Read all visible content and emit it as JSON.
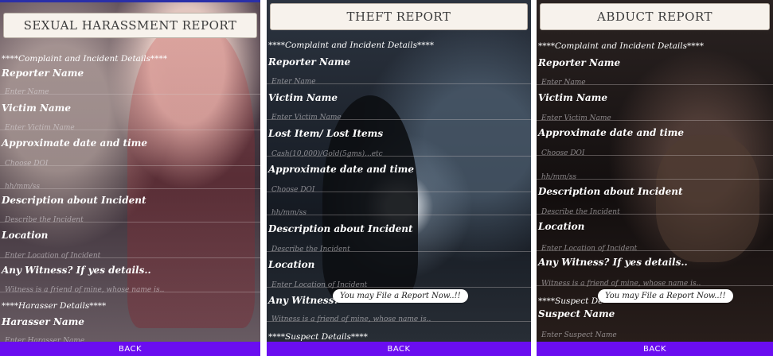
{
  "screens": [
    {
      "title": "SEXUAL HARASSMENT REPORT",
      "section_header": "****Complaint and Incident Details****",
      "reporter_label": "Reporter Name",
      "reporter_placeholder": "Enter Name",
      "victim_label": "Victim Name",
      "victim_placeholder": "Enter Victim Name",
      "datetime_label": "Approximate date and time",
      "date_placeholder": "Choose DOI",
      "time_placeholder": "hh/mm/ss",
      "description_label": "Description about Incident",
      "description_placeholder": "Describe the Incident",
      "location_label": "Location",
      "location_placeholder": "Enter Location of Incident",
      "witness_label": "Any Witness? If yes details..",
      "witness_placeholder": "Witness is a friend of mine, whose name is..",
      "section2_header": "****Harasser Details****",
      "harasser_label": "Harasser Name",
      "harasser_placeholder": "Enter Harasser Name",
      "back_label": "BACK"
    },
    {
      "title": "THEFT REPORT",
      "section_header": "****Complaint and Incident Details****",
      "reporter_label": "Reporter Name",
      "reporter_placeholder": "Enter Name",
      "victim_label": "Victim Name",
      "victim_placeholder": "Enter Victim Name",
      "lost_label": "Lost Item/ Lost Items",
      "lost_placeholder": "Cash(10,000)/Gold(5gms)...etc",
      "datetime_label": "Approximate date and time",
      "date_placeholder": "Choose DOI",
      "time_placeholder": "hh/mm/ss",
      "description_label": "Description about Incident",
      "description_placeholder": "Describe the Incident",
      "location_label": "Location",
      "location_placeholder": "Enter Location of Incident",
      "witness_label": "Any Witness?",
      "witness_placeholder": "Witness is a friend of mine, whose name is..",
      "section2_header": "****Suspect Details****",
      "toast": "You may File a Report Now..!!",
      "back_label": "BACK"
    },
    {
      "title": "ABDUCT REPORT",
      "section_header": "****Complaint and Incident Details****",
      "reporter_label": "Reporter Name",
      "reporter_placeholder": "Enter Name",
      "victim_label": "Victim Name",
      "victim_placeholder": "Enter Victim Name",
      "datetime_label": "Approximate date and time",
      "date_placeholder": "Choose DOI",
      "time_placeholder": "hh/mm/ss",
      "description_label": "Description about Incident",
      "description_placeholder": "Describe the Incident",
      "location_label": "Location",
      "location_placeholder": "Enter Location of Incident",
      "witness_label": "Any Witness? If yes details..",
      "witness_placeholder": "Witness is a friend of mine, whose name is..",
      "section2_header": "****Suspect De",
      "suspect_label": "Suspect Name",
      "suspect_placeholder": "Enter Suspect Name",
      "toast": "You may File a Report Now..!!",
      "back_label": "BACK"
    }
  ],
  "colors": {
    "back_bar": "#6a0df0",
    "title_bg": "#f7f2ec"
  }
}
